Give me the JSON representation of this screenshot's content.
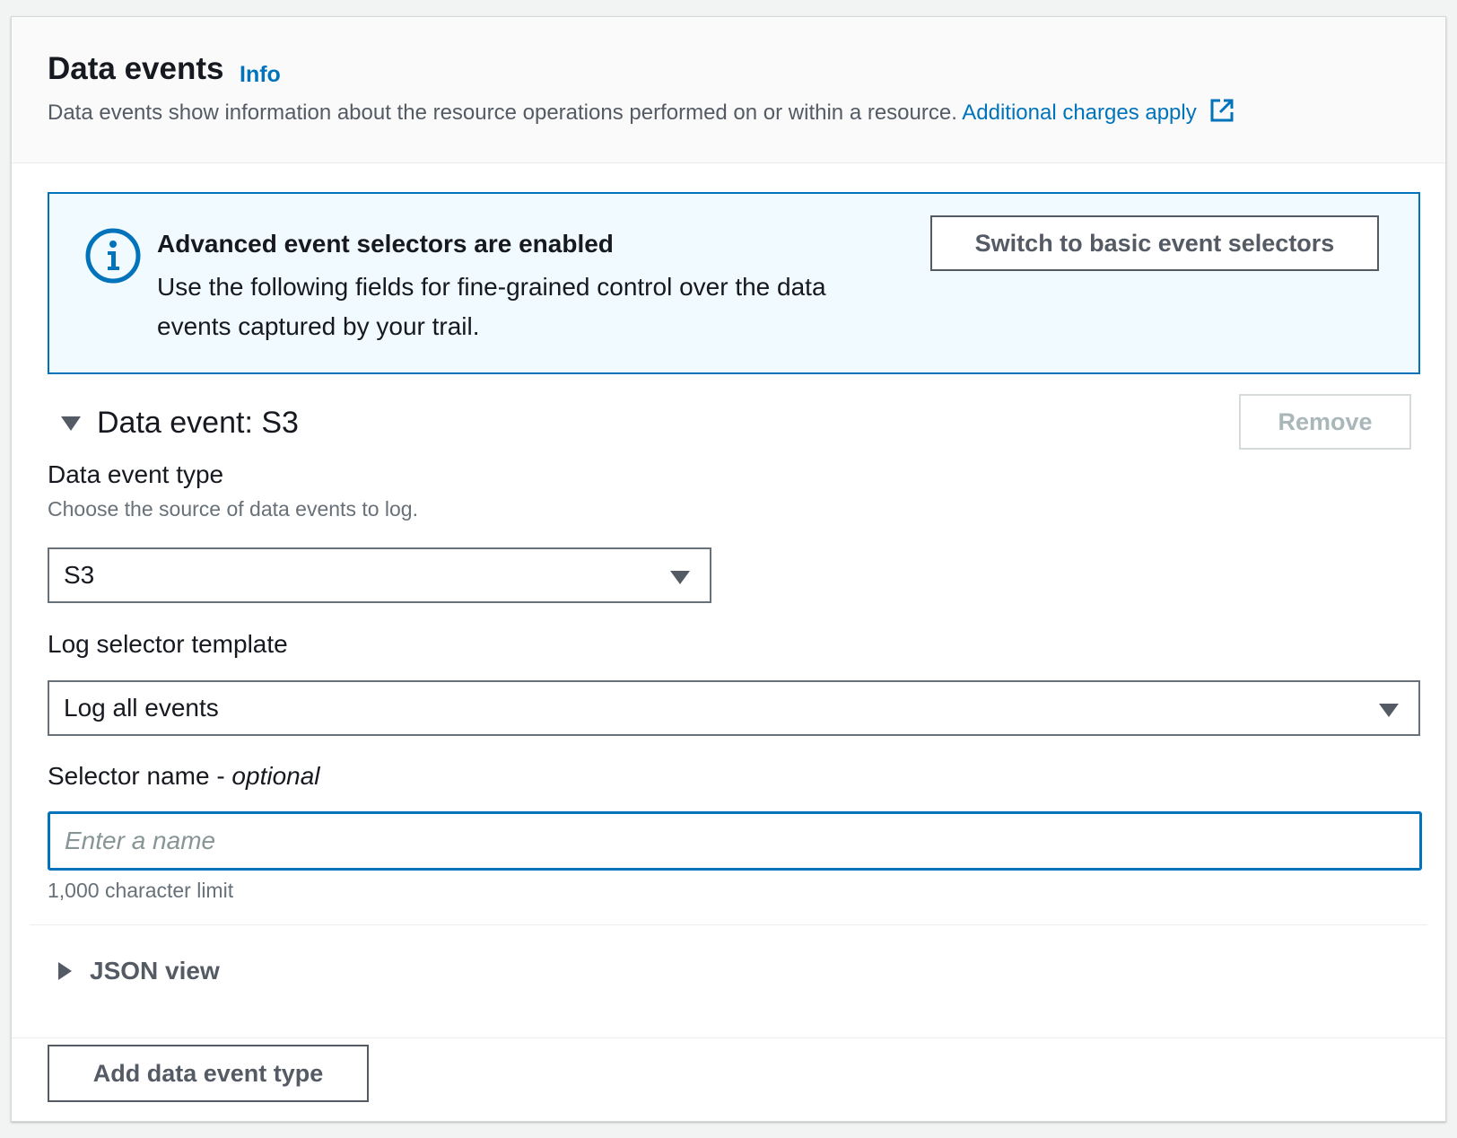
{
  "header": {
    "title": "Data events",
    "info_link": "Info",
    "description": "Data events show information about the resource operations performed on or within a resource.",
    "charges_link": "Additional charges apply"
  },
  "alert": {
    "title": "Advanced event selectors are enabled",
    "body": "Use the following fields for fine-grained control over the data events captured by your trail.",
    "button": "Switch to basic event selectors",
    "icon": "info-circle-icon"
  },
  "data_event": {
    "title": "Data event: S3",
    "remove_button": "Remove",
    "type_label": "Data event type",
    "type_hint": "Choose the source of data events to log.",
    "type_value": "S3",
    "template_label": "Log selector template",
    "template_value": "Log all events",
    "name_label": "Selector name - ",
    "name_label_optional": "optional",
    "name_placeholder": "Enter a name",
    "name_value": "",
    "name_hint": "1,000 character limit"
  },
  "json_view": {
    "label": "JSON view"
  },
  "footer": {
    "add_button": "Add data event type"
  },
  "colors": {
    "link": "#0073bb",
    "alert_bg": "#f1faff",
    "text": "#16191f",
    "muted": "#545b64"
  }
}
